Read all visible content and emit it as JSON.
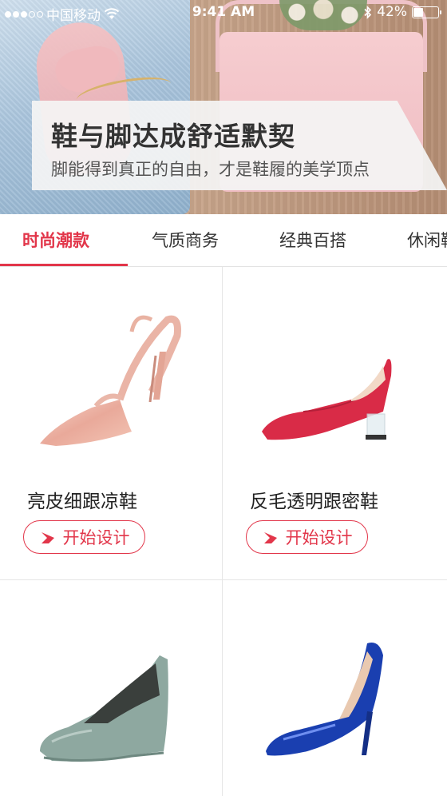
{
  "status_bar": {
    "carrier": "中国移动",
    "time": "9:41 AM",
    "battery": "42%",
    "battery_level": 0.42
  },
  "banner": {
    "title": "鞋与脚达成舒适默契",
    "subtitle": "脚能得到真正的自由，才是鞋履的美学顶点"
  },
  "tabs": [
    {
      "label": "时尚潮款",
      "active": true
    },
    {
      "label": "气质商务",
      "active": false
    },
    {
      "label": "经典百搭",
      "active": false
    },
    {
      "label": "休闲鞋",
      "active": false
    }
  ],
  "products": [
    {
      "name": "亮皮细跟凉鞋",
      "button": "开始设计",
      "color": "#f0b9ad"
    },
    {
      "name": "反毛透明跟密鞋",
      "button": "开始设计",
      "color": "#d92b47"
    },
    {
      "name": "",
      "button": "",
      "color": "#8ea8a0"
    },
    {
      "name": "",
      "button": "",
      "color": "#1a3fb0"
    }
  ],
  "colors": {
    "accent": "#e2364a"
  }
}
